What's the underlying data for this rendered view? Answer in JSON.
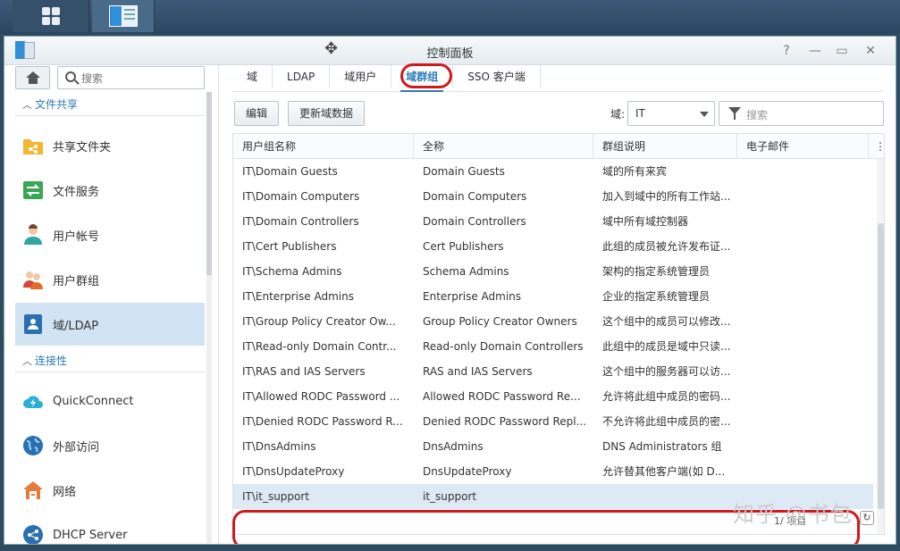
{
  "window": {
    "title": "控制面板"
  },
  "sidebar": {
    "search_placeholder": "搜索",
    "sections": [
      {
        "label": "文件共享",
        "items": [
          "共享文件夹",
          "文件服务",
          "用户帐号",
          "用户群组",
          "域/LDAP"
        ]
      },
      {
        "label": "连接性",
        "items": [
          "QuickConnect",
          "外部访问",
          "网络",
          "DHCP Server"
        ]
      }
    ],
    "active_item": "域/LDAP"
  },
  "tabs": [
    "域",
    "LDAP",
    "域用户",
    "域群组",
    "SSO 客户端"
  ],
  "active_tab": "域群组",
  "toolbar": {
    "edit_label": "编辑",
    "update_label": "更新域数据",
    "domain_label": "域:",
    "domain_value": "IT",
    "search_placeholder": "搜索"
  },
  "table": {
    "columns": [
      "用户组名称",
      "全称",
      "群组说明",
      "电子邮件"
    ],
    "rows": [
      [
        "IT\\Domain Guests",
        "Domain Guests",
        "域的所有来宾",
        ""
      ],
      [
        "IT\\Domain Computers",
        "Domain Computers",
        "加入到域中的所有工作站...",
        ""
      ],
      [
        "IT\\Domain Controllers",
        "Domain Controllers",
        "域中所有域控制器",
        ""
      ],
      [
        "IT\\Cert Publishers",
        "Cert Publishers",
        "此组的成员被允许发布证...",
        ""
      ],
      [
        "IT\\Schema Admins",
        "Schema Admins",
        "架构的指定系统管理员",
        ""
      ],
      [
        "IT\\Enterprise Admins",
        "Enterprise Admins",
        "企业的指定系统管理员",
        ""
      ],
      [
        "IT\\Group Policy Creator Ow...",
        "Group Policy Creator Owners",
        "这个组中的成员可以修改...",
        ""
      ],
      [
        "IT\\Read-only Domain Contr...",
        "Read-only Domain Controllers",
        "此组中的成员是域中只读...",
        ""
      ],
      [
        "IT\\RAS and IAS Servers",
        "RAS and IAS Servers",
        "这个组中的服务器可以访...",
        ""
      ],
      [
        "IT\\Allowed RODC Password ...",
        "Allowed RODC Password Re...",
        "允许将此组中成员的密码...",
        ""
      ],
      [
        "IT\\Denied RODC Password R...",
        "Denied RODC Password Repl...",
        "不允许将此组中成员的密...",
        ""
      ],
      [
        "IT\\DnsAdmins",
        "DnsAdmins",
        "DNS Administrators 组",
        ""
      ],
      [
        "IT\\DnsUpdateProxy",
        "DnsUpdateProxy",
        "允许替其他客户端(如 D...",
        ""
      ],
      [
        "IT\\it_support",
        "it_support",
        "",
        ""
      ]
    ],
    "selected_row": 13,
    "footer_text": "1/ 项目"
  },
  "watermark": "知乎 @书包",
  "colors": {
    "accent": "#2a7ab8",
    "selection": "#d2e3f3",
    "highlight": "#d0191b"
  }
}
